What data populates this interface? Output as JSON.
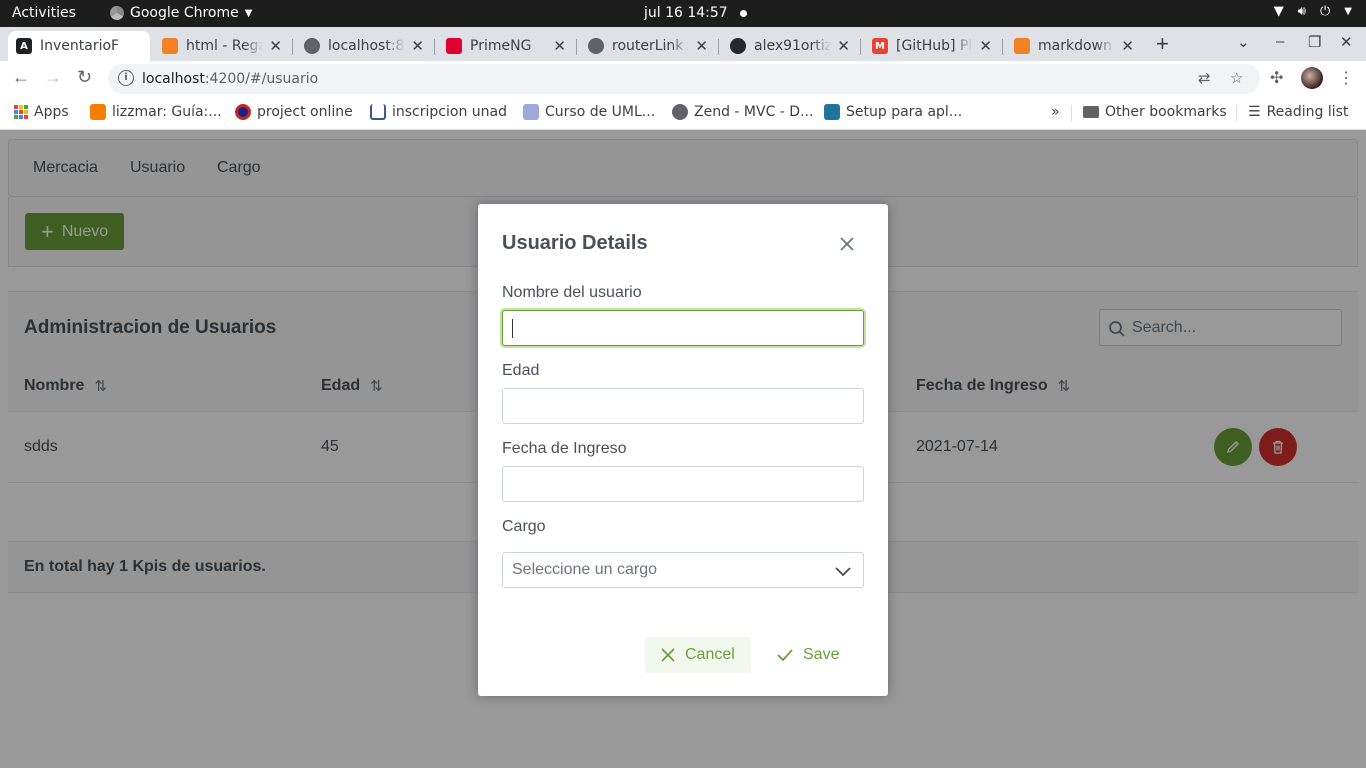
{
  "system_bar": {
    "activities": "Activities",
    "app_name": "Google Chrome",
    "clock": "jul 16  14:57"
  },
  "browser": {
    "tabs": [
      {
        "label": "InventarioF",
        "icon": "angular-icon",
        "color": "#202124"
      },
      {
        "label": "html - Rega",
        "icon": "stackoverflow-icon",
        "color": "#f48024"
      },
      {
        "label": "localhost:8",
        "icon": "globe-icon",
        "color": "#5f6368"
      },
      {
        "label": "PrimeNG",
        "icon": "primeng-icon",
        "color": "#dd0031"
      },
      {
        "label": "routerLink",
        "icon": "globe-icon",
        "color": "#5f6368"
      },
      {
        "label": "alex91ortiz",
        "icon": "github-icon",
        "color": "#24292e"
      },
      {
        "label": "[GitHub] Pl",
        "icon": "gmail-icon",
        "color": "#ea4335"
      },
      {
        "label": "markdown",
        "icon": "stackoverflow-icon",
        "color": "#f48024"
      }
    ],
    "url_host": "localhost",
    "url_path": ":4200/#/usuario",
    "bookmarks": [
      {
        "label": "Apps"
      },
      {
        "label": "lizzmar: Guía:..."
      },
      {
        "label": "project online"
      },
      {
        "label": "inscripcion unad"
      },
      {
        "label": "Curso de UML..."
      },
      {
        "label": "Zend - MVC - D..."
      },
      {
        "label": "Setup para apl..."
      }
    ],
    "overflow": "»",
    "other_bookmarks": "Other bookmarks",
    "reading_list": "Reading list"
  },
  "app": {
    "menu": [
      "Mercacia",
      "Usuario",
      "Cargo"
    ],
    "new_button": "Nuevo",
    "table_title": "Administracion de Usuarios",
    "search_placeholder": "Search...",
    "columns": [
      "Nombre",
      "Edad",
      "Fecha de Ingreso"
    ],
    "rows": [
      {
        "nombre": "sdds",
        "edad": "45",
        "fecha": "2021-07-14"
      }
    ],
    "footer": "En total hay 1 Kpis de usuarios."
  },
  "dialog": {
    "title": "Usuario Details",
    "fields": {
      "nombre_label": "Nombre del usuario",
      "nombre_value": "",
      "edad_label": "Edad",
      "edad_value": "",
      "fecha_label": "Fecha de Ingreso",
      "fecha_value": "",
      "cargo_label": "Cargo",
      "cargo_placeholder": "Seleccione un cargo"
    },
    "cancel": "Cancel",
    "save": "Save"
  },
  "colors": {
    "primary": "#689f38",
    "danger": "#d32f2f"
  }
}
